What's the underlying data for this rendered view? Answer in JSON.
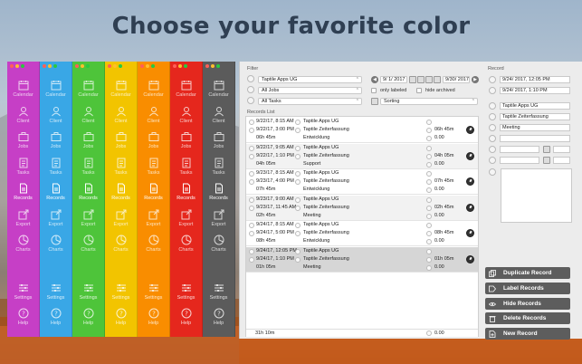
{
  "headline": "Choose your favorite color",
  "sidebars": [
    {
      "color": "#c63fc6"
    },
    {
      "color": "#39a7e6"
    },
    {
      "color": "#4ec43a"
    },
    {
      "color": "#f2c400"
    },
    {
      "color": "#f98d00"
    },
    {
      "color": "#e5271d"
    },
    {
      "color": "#5b5b5b"
    }
  ],
  "nav_items": [
    {
      "label": "Calendar",
      "icon": "calendar-icon"
    },
    {
      "label": "Client",
      "icon": "person-icon"
    },
    {
      "label": "Jobs",
      "icon": "briefcase-icon"
    },
    {
      "label": "Tasks",
      "icon": "checklist-icon"
    },
    {
      "label": "Records",
      "icon": "document-icon"
    },
    {
      "label": "Export",
      "icon": "export-icon"
    },
    {
      "label": "Charts",
      "icon": "pie-chart-icon"
    }
  ],
  "bottom_nav": [
    {
      "label": "Settings",
      "icon": "sliders-icon"
    },
    {
      "label": "Help",
      "icon": "help-icon"
    }
  ],
  "filter": {
    "title": "Filter",
    "client": "Taptile Apps UG",
    "jobs": "All Jobs",
    "tasks": "All Tasks",
    "date_from": "9/  1/ 2017",
    "date_to": "9/30/ 2017",
    "only_labeled": "only labeled",
    "hide_archived": "hide archived",
    "sorting": "Sorting"
  },
  "records_list": {
    "title": "Records List",
    "rows": [
      {
        "start": "9/22/17, 8:15 AM",
        "end": "9/22/17, 3:00 PM",
        "duration": "06h 45m",
        "client": "Taptile Apps UG",
        "job": "Taptile Zeiterfassung",
        "task": "Entwicklung",
        "time": "06h 45m",
        "amount": "0.00"
      },
      {
        "start": "9/22/17, 9:05 AM",
        "end": "9/22/17, 1:10 PM",
        "duration": "04h 05m",
        "client": "Taptile Apps UG",
        "job": "Taptile Zeiterfassung",
        "task": "Support",
        "time": "04h 05m",
        "amount": "0.00"
      },
      {
        "start": "9/23/17, 8:15 AM",
        "end": "9/23/17, 4:00 PM",
        "duration": "07h 45m",
        "client": "Taptile Apps UG",
        "job": "Taptile Zeiterfassung",
        "task": "Entwicklung",
        "time": "07h 45m",
        "amount": "0.00"
      },
      {
        "start": "9/23/17, 9:00 AM",
        "end": "9/23/17, 11:45 AM",
        "duration": "02h 45m",
        "client": "Taptile Apps UG",
        "job": "Taptile Zeiterfassung",
        "task": "Meeting",
        "time": "02h 45m",
        "amount": "0.00"
      },
      {
        "start": "9/24/17, 8:15 AM",
        "end": "9/24/17, 5:00 PM",
        "duration": "08h 45m",
        "client": "Taptile Apps UG",
        "job": "Taptile Zeiterfassung",
        "task": "Entwicklung",
        "time": "08h 45m",
        "amount": "0.00"
      },
      {
        "start": "9/24/17, 12:05 PM",
        "end": "9/24/17, 1:10 PM",
        "duration": "01h 05m",
        "client": "Taptile Apps UG",
        "job": "Taptile Zeiterfassung",
        "task": "Meeting",
        "time": "01h 05m",
        "amount": "0.00"
      }
    ],
    "total": "31h 10m",
    "total_amount": "0.00"
  },
  "record": {
    "title": "Record",
    "start": "9/24/ 2017, 12:05 PM",
    "end": "9/24/ 2017,   1:10 PM",
    "client": "Taptile Apps UG",
    "job": "Taptile Zeiterfassung",
    "task": "Meeting"
  },
  "actions": [
    {
      "label": "Duplicate Record",
      "icon": "duplicate-icon"
    },
    {
      "label": "Label Records",
      "icon": "label-icon"
    },
    {
      "label": "Hide Records",
      "icon": "eye-icon"
    },
    {
      "label": "Delete Records",
      "icon": "trash-icon"
    },
    {
      "label": "New Record",
      "icon": "new-record-icon"
    }
  ]
}
